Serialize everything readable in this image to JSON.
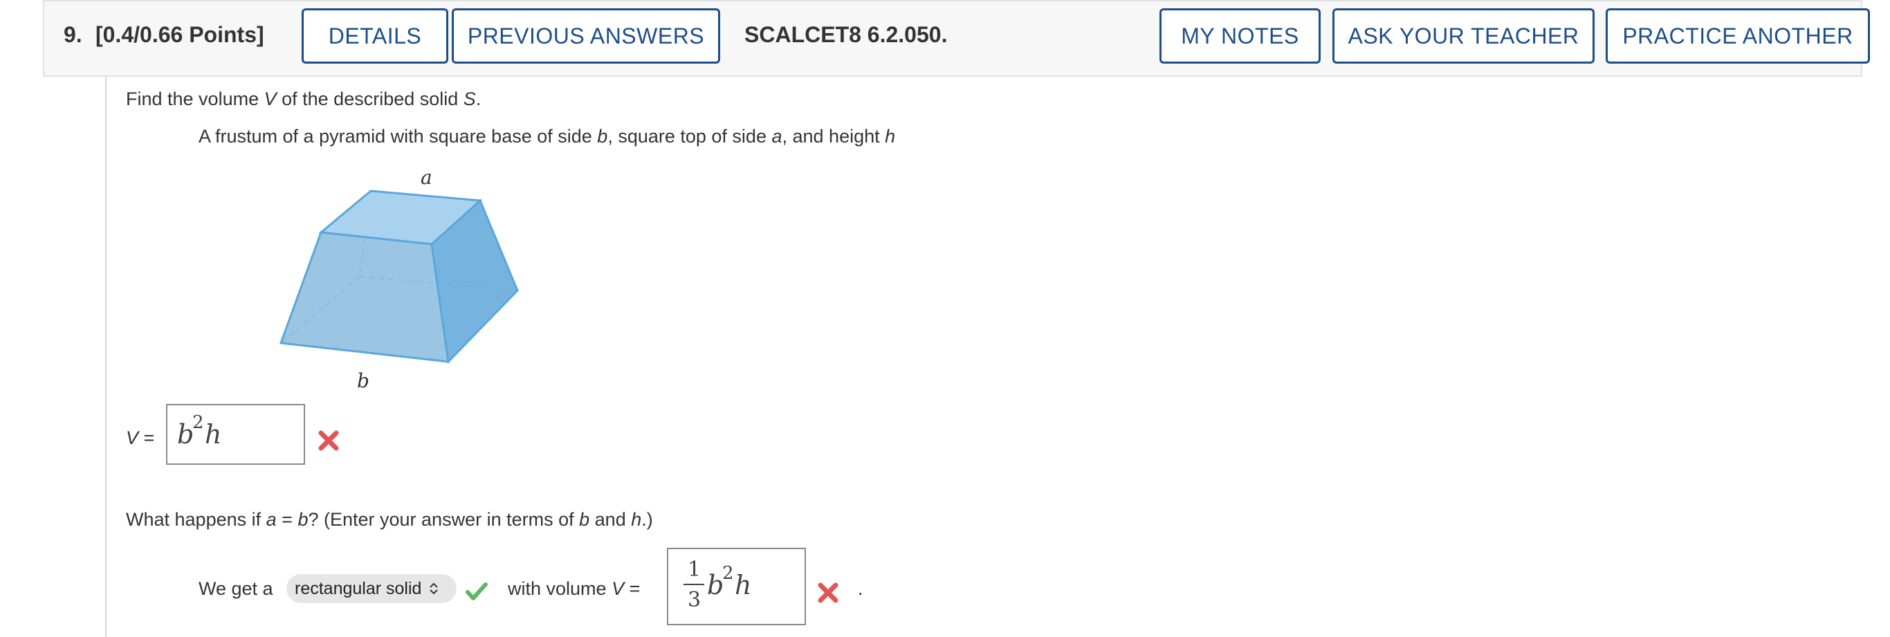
{
  "header": {
    "question_number": "9.",
    "points": "[0.4/0.66 Points]",
    "details_label": "DETAILS",
    "previous_answers_label": "PREVIOUS ANSWERS",
    "problem_code": "SCALCET8 6.2.050.",
    "my_notes_label": "MY NOTES",
    "ask_teacher_label": "ASK YOUR TEACHER",
    "practice_another_label": "PRACTICE ANOTHER"
  },
  "question": {
    "prompt_part1": "Find the volume ",
    "prompt_var_v": "V",
    "prompt_part2": " of the described solid ",
    "prompt_var_s": "S",
    "prompt_end": ".",
    "description_part1": "A frustum of a pyramid with square base of side ",
    "description_b": "b",
    "description_part2": ", square top of side ",
    "description_a": "a",
    "description_part3": ", and height ",
    "description_h": "h"
  },
  "figure": {
    "label_top": "a",
    "label_bottom": "b"
  },
  "answer1": {
    "label_var": "V",
    "label_eq": " =",
    "value_base": "b",
    "value_exp": "2",
    "value_var": "h",
    "status": "incorrect"
  },
  "part2": {
    "prompt_part1": "What happens if ",
    "prompt_a": "a",
    "prompt_part2": " = ",
    "prompt_b": "b",
    "prompt_part3": "? (Enter your answer in terms of ",
    "prompt_b2": "b",
    "prompt_part4": " and ",
    "prompt_h": "h",
    "prompt_part5": ".)",
    "we_get_label": "We get a",
    "select_value": "rectangular solid",
    "select_status": "correct",
    "with_volume_label": "with volume ",
    "with_volume_var": "V",
    "with_volume_eq": " =",
    "frac_num": "1",
    "frac_den": "3",
    "value_base": "b",
    "value_exp": "2",
    "value_var": "h",
    "status": "incorrect",
    "trailing": "."
  },
  "colors": {
    "button_border": "#1d4e89",
    "incorrect": "#e05555",
    "correct": "#5cb85c",
    "solid_fill": "#8fc2e4"
  }
}
